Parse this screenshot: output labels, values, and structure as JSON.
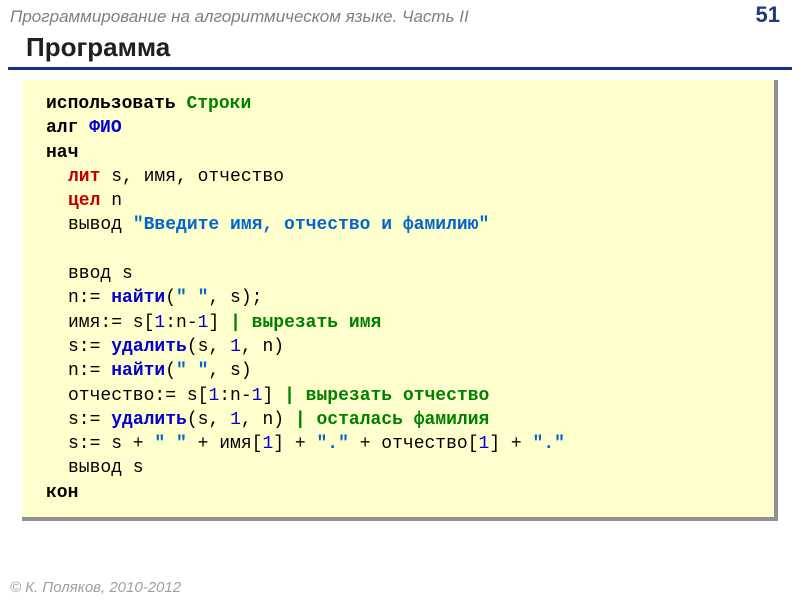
{
  "header": {
    "breadcrumb": "Программирование на алгоритмическом языке. Часть II",
    "page": "51"
  },
  "title": "Программа",
  "code": {
    "use": "использовать",
    "module": "Строки",
    "alg": "алг",
    "algname": "ФИО",
    "begin": "нач",
    "lit": "лит",
    "vars1": " s, имя, отчество",
    "int": "цел",
    "vars2": " n",
    "out": "вывод ",
    "prompt": "\"Введите имя, отчество и фамилию\"",
    "in": "ввод s",
    "l1a": "n:= ",
    "find": "найти",
    "l1b": "(",
    "l1s": "\" \"",
    "l1c": ", s);",
    "l2a": "имя:= s[",
    "one": "1",
    "l2b": ":n-",
    "l2c": "]",
    "l2cmt": "  | вырезать имя",
    "l3a": "s:= ",
    "del": "удалить",
    "l3b": "(s, ",
    "l3c": ", n)",
    "l4c": ", s)",
    "l5a": "отчество:= s[",
    "l5cmt": "   | вырезать отчество",
    "l6cmt": "  | осталась фамилия",
    "l7a": "s:= s + ",
    "sp": "\" \"",
    "l7b": " + имя[",
    "l7c": "] + ",
    "dot": "\".\"",
    "l7d": " + отчество[",
    "l8": "вывод s",
    "end": "кон"
  },
  "footer": "© К. Поляков, 2010-2012"
}
